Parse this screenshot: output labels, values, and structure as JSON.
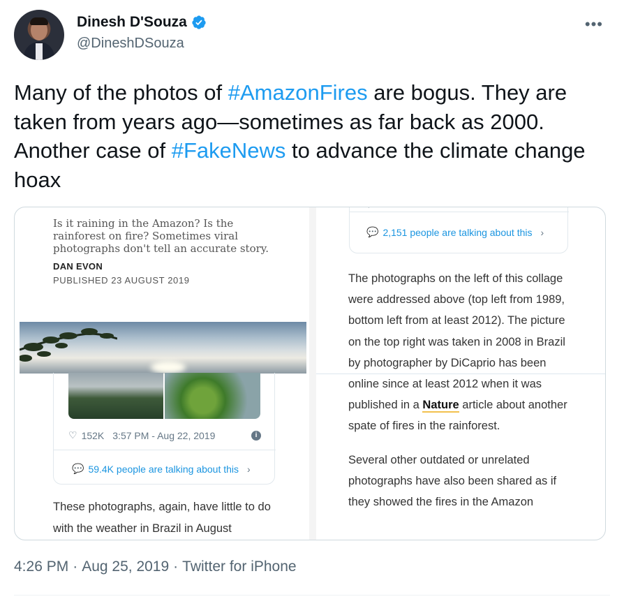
{
  "author": {
    "display_name": "Dinesh D'Souza",
    "handle": "@DineshDSouza",
    "verified": true,
    "more_label": "•••"
  },
  "tweet": {
    "text_1": "Many of the photos of ",
    "hashtag_1": "#AmazonFires",
    "text_2": " are bogus. They are taken from years ago—sometimes as far back as 2000. Another case of ",
    "hashtag_2": "#FakeNews",
    "text_3": " to advance the climate change hoax"
  },
  "media": {
    "left": {
      "subhead": "Is it raining in the Amazon? Is the rainforest on fire? Sometimes viral photographs don't tell an accurate story.",
      "author": "DAN EVON",
      "published": "PUBLISHED 23 AUGUST 2019",
      "embed_likes": "152K",
      "embed_time": "3:57 PM - Aug 22, 2019",
      "embed_talking": "59.4K people are talking about this",
      "body": "These photographs, again, have little to do with the weather in Brazil in August"
    },
    "right": {
      "embed_talking": "2,151 people are talking about this",
      "para1_a": "The photographs on the left of this collage were addressed above (top left from 1989, bottom left from at least 2012). The picture on the top right was taken in 2008 in Brazil by photographer by DiCaprio has been online since at least 2012 when it was published in a ",
      "para1_link": "Nature",
      "para1_b": " article about another spate of fires in the rainforest.",
      "para2": "Several other outdated or unrelated photographs have also been shared as if they showed the fires in the Amazon"
    }
  },
  "footer": {
    "time": "4:26 PM",
    "sep1": "·",
    "date": "Aug 25, 2019",
    "sep2": "·",
    "client": "Twitter for iPhone"
  },
  "colors": {
    "link": "#1d9bf0",
    "verified_badge": "#1d9bf0",
    "secondary_text": "#536471"
  }
}
